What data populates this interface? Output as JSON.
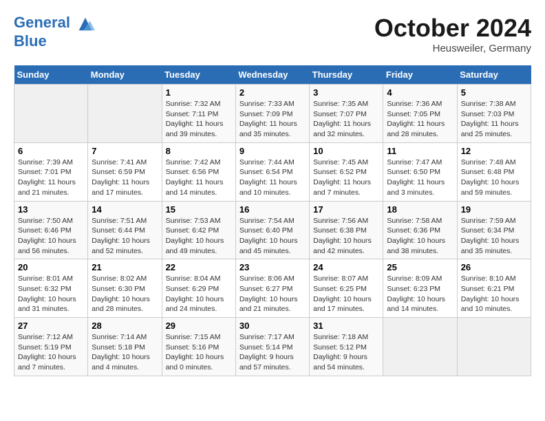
{
  "header": {
    "logo_line1": "General",
    "logo_line2": "Blue",
    "month": "October 2024",
    "location": "Heusweiler, Germany"
  },
  "weekdays": [
    "Sunday",
    "Monday",
    "Tuesday",
    "Wednesday",
    "Thursday",
    "Friday",
    "Saturday"
  ],
  "weeks": [
    [
      {
        "num": "",
        "text": ""
      },
      {
        "num": "",
        "text": ""
      },
      {
        "num": "1",
        "text": "Sunrise: 7:32 AM\nSunset: 7:11 PM\nDaylight: 11 hours and 39 minutes."
      },
      {
        "num": "2",
        "text": "Sunrise: 7:33 AM\nSunset: 7:09 PM\nDaylight: 11 hours and 35 minutes."
      },
      {
        "num": "3",
        "text": "Sunrise: 7:35 AM\nSunset: 7:07 PM\nDaylight: 11 hours and 32 minutes."
      },
      {
        "num": "4",
        "text": "Sunrise: 7:36 AM\nSunset: 7:05 PM\nDaylight: 11 hours and 28 minutes."
      },
      {
        "num": "5",
        "text": "Sunrise: 7:38 AM\nSunset: 7:03 PM\nDaylight: 11 hours and 25 minutes."
      }
    ],
    [
      {
        "num": "6",
        "text": "Sunrise: 7:39 AM\nSunset: 7:01 PM\nDaylight: 11 hours and 21 minutes."
      },
      {
        "num": "7",
        "text": "Sunrise: 7:41 AM\nSunset: 6:59 PM\nDaylight: 11 hours and 17 minutes."
      },
      {
        "num": "8",
        "text": "Sunrise: 7:42 AM\nSunset: 6:56 PM\nDaylight: 11 hours and 14 minutes."
      },
      {
        "num": "9",
        "text": "Sunrise: 7:44 AM\nSunset: 6:54 PM\nDaylight: 11 hours and 10 minutes."
      },
      {
        "num": "10",
        "text": "Sunrise: 7:45 AM\nSunset: 6:52 PM\nDaylight: 11 hours and 7 minutes."
      },
      {
        "num": "11",
        "text": "Sunrise: 7:47 AM\nSunset: 6:50 PM\nDaylight: 11 hours and 3 minutes."
      },
      {
        "num": "12",
        "text": "Sunrise: 7:48 AM\nSunset: 6:48 PM\nDaylight: 10 hours and 59 minutes."
      }
    ],
    [
      {
        "num": "13",
        "text": "Sunrise: 7:50 AM\nSunset: 6:46 PM\nDaylight: 10 hours and 56 minutes."
      },
      {
        "num": "14",
        "text": "Sunrise: 7:51 AM\nSunset: 6:44 PM\nDaylight: 10 hours and 52 minutes."
      },
      {
        "num": "15",
        "text": "Sunrise: 7:53 AM\nSunset: 6:42 PM\nDaylight: 10 hours and 49 minutes."
      },
      {
        "num": "16",
        "text": "Sunrise: 7:54 AM\nSunset: 6:40 PM\nDaylight: 10 hours and 45 minutes."
      },
      {
        "num": "17",
        "text": "Sunrise: 7:56 AM\nSunset: 6:38 PM\nDaylight: 10 hours and 42 minutes."
      },
      {
        "num": "18",
        "text": "Sunrise: 7:58 AM\nSunset: 6:36 PM\nDaylight: 10 hours and 38 minutes."
      },
      {
        "num": "19",
        "text": "Sunrise: 7:59 AM\nSunset: 6:34 PM\nDaylight: 10 hours and 35 minutes."
      }
    ],
    [
      {
        "num": "20",
        "text": "Sunrise: 8:01 AM\nSunset: 6:32 PM\nDaylight: 10 hours and 31 minutes."
      },
      {
        "num": "21",
        "text": "Sunrise: 8:02 AM\nSunset: 6:30 PM\nDaylight: 10 hours and 28 minutes."
      },
      {
        "num": "22",
        "text": "Sunrise: 8:04 AM\nSunset: 6:29 PM\nDaylight: 10 hours and 24 minutes."
      },
      {
        "num": "23",
        "text": "Sunrise: 8:06 AM\nSunset: 6:27 PM\nDaylight: 10 hours and 21 minutes."
      },
      {
        "num": "24",
        "text": "Sunrise: 8:07 AM\nSunset: 6:25 PM\nDaylight: 10 hours and 17 minutes."
      },
      {
        "num": "25",
        "text": "Sunrise: 8:09 AM\nSunset: 6:23 PM\nDaylight: 10 hours and 14 minutes."
      },
      {
        "num": "26",
        "text": "Sunrise: 8:10 AM\nSunset: 6:21 PM\nDaylight: 10 hours and 10 minutes."
      }
    ],
    [
      {
        "num": "27",
        "text": "Sunrise: 7:12 AM\nSunset: 5:19 PM\nDaylight: 10 hours and 7 minutes."
      },
      {
        "num": "28",
        "text": "Sunrise: 7:14 AM\nSunset: 5:18 PM\nDaylight: 10 hours and 4 minutes."
      },
      {
        "num": "29",
        "text": "Sunrise: 7:15 AM\nSunset: 5:16 PM\nDaylight: 10 hours and 0 minutes."
      },
      {
        "num": "30",
        "text": "Sunrise: 7:17 AM\nSunset: 5:14 PM\nDaylight: 9 hours and 57 minutes."
      },
      {
        "num": "31",
        "text": "Sunrise: 7:18 AM\nSunset: 5:12 PM\nDaylight: 9 hours and 54 minutes."
      },
      {
        "num": "",
        "text": ""
      },
      {
        "num": "",
        "text": ""
      }
    ]
  ]
}
